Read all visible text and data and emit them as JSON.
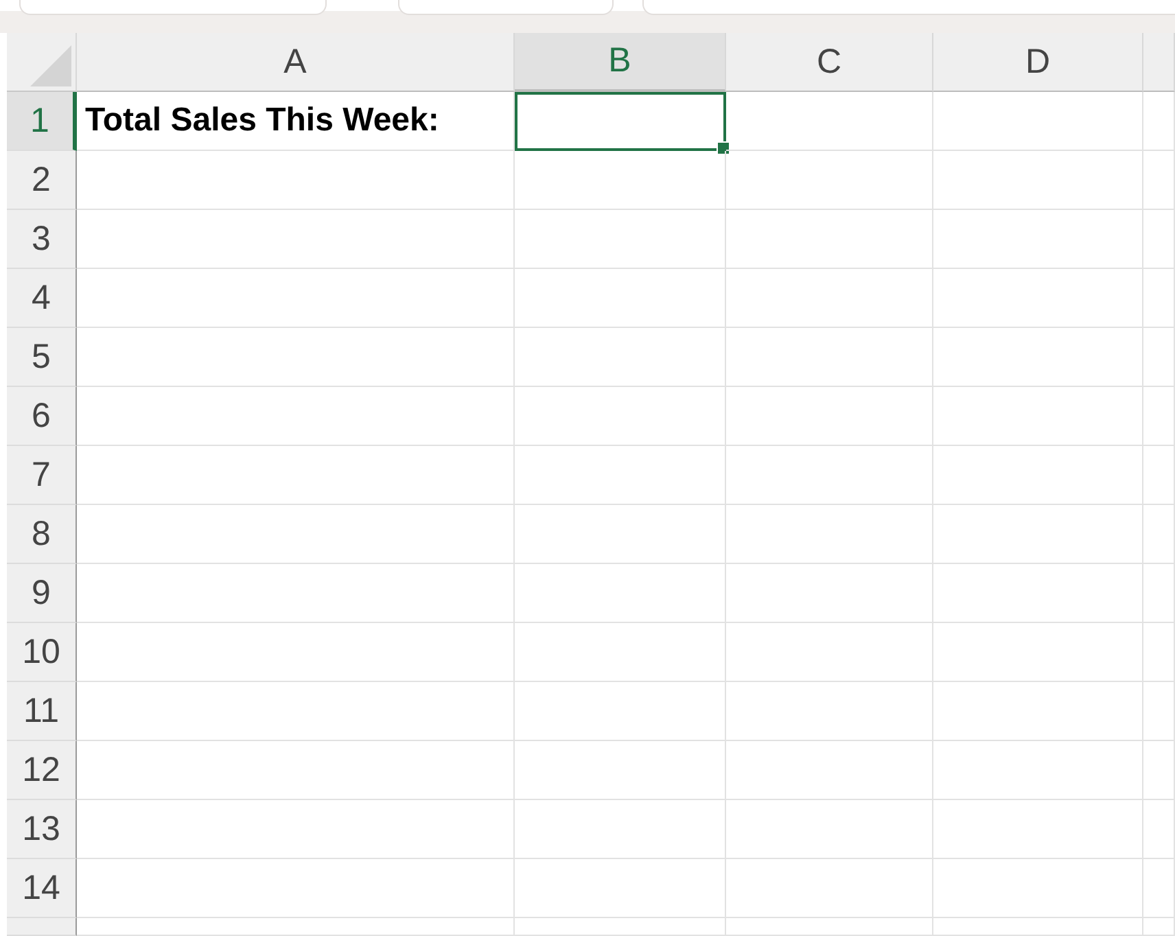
{
  "columns": [
    {
      "label": "A",
      "selected": false
    },
    {
      "label": "B",
      "selected": true
    },
    {
      "label": "C",
      "selected": false
    },
    {
      "label": "D",
      "selected": false
    }
  ],
  "rows": [
    {
      "label": "1",
      "selected": true,
      "a": "Total Sales This Week:"
    },
    {
      "label": "2",
      "selected": false
    },
    {
      "label": "3",
      "selected": false
    },
    {
      "label": "4",
      "selected": false
    },
    {
      "label": "5",
      "selected": false
    },
    {
      "label": "6",
      "selected": false
    },
    {
      "label": "7",
      "selected": false
    },
    {
      "label": "8",
      "selected": false
    },
    {
      "label": "9",
      "selected": false
    },
    {
      "label": "10",
      "selected": false
    },
    {
      "label": "11",
      "selected": false
    },
    {
      "label": "12",
      "selected": false
    },
    {
      "label": "13",
      "selected": false
    },
    {
      "label": "14",
      "selected": false
    }
  ]
}
